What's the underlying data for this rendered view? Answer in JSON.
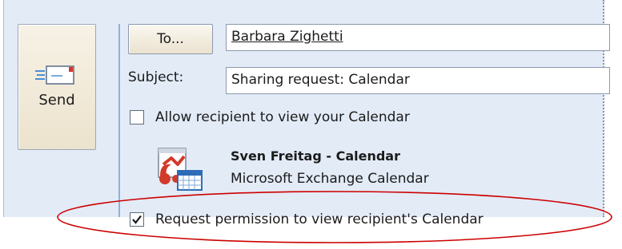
{
  "toolbar": {
    "send_label": "Send",
    "send_icon": "envelope-send-icon"
  },
  "recipients": {
    "to_button_label": "To...",
    "to_value": "Barbara Zighetti"
  },
  "subject": {
    "label": "Subject:",
    "value": "Sharing request: Calendar"
  },
  "sharing": {
    "allow_view": {
      "label": "Allow recipient to view your Calendar",
      "checked": false
    },
    "calendar": {
      "icon": "shared-calendar-icon",
      "title": "Sven Freitag - Calendar",
      "subtitle": "Microsoft Exchange Calendar"
    },
    "request_permission": {
      "label": "Request permission to view recipient's Calendar",
      "checked": true
    }
  },
  "colors": {
    "form_background": "#e3ebf7",
    "highlight_ellipse": "#cc0000",
    "field_border": "#8c99ad"
  }
}
